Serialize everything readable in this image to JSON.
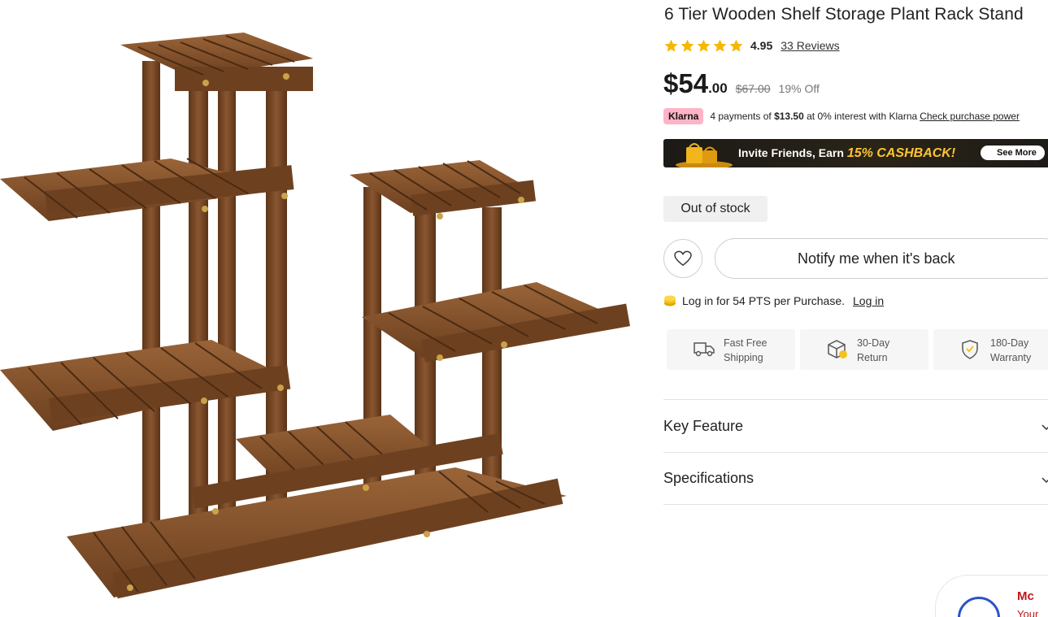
{
  "product": {
    "title": "6 Tier Wooden Shelf Storage Plant Rack Stand",
    "rating": 5,
    "rating_value": "4.95",
    "reviews_label": "33 Reviews",
    "price_dollars": "$54",
    "price_cents": ".00",
    "price_original": "$67.00",
    "discount": "19% Off"
  },
  "klarna": {
    "badge": "Klarna",
    "prefix": "4 payments of",
    "amount": "$13.50",
    "suffix": "at 0% interest with Klarna",
    "link": "Check purchase power"
  },
  "banner": {
    "text": "Invite Friends, Earn",
    "highlight": "15% CASHBACK!",
    "button": "See More"
  },
  "stock_status": "Out of stock",
  "notify_label": "Notify me when it's back",
  "points": {
    "text": "Log in for 54 PTS per Purchase.",
    "link": "Log in"
  },
  "services": [
    {
      "label": "Fast Free Shipping",
      "icon": "truck-icon"
    },
    {
      "label": "30-Day Return",
      "icon": "return-box-icon"
    },
    {
      "label": "180-Day Warranty",
      "icon": "shield-check-icon"
    }
  ],
  "accordions": [
    {
      "title": "Key Feature"
    },
    {
      "title": "Specifications"
    }
  ],
  "widget": {
    "brand": "Mc",
    "sub": "Your"
  },
  "colors": {
    "star": "#f5b800",
    "klarna_pink": "#ffb3c7",
    "cashback_gold": "#ffc531",
    "wood": "#7a4a2a"
  }
}
